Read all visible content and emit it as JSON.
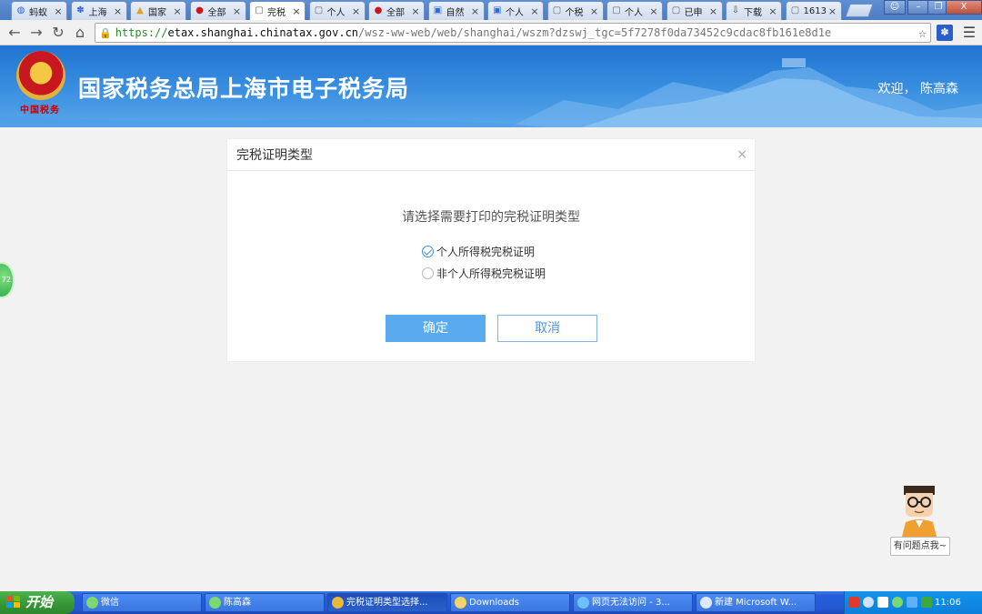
{
  "browser": {
    "tabs": [
      {
        "label": "蚂蚁",
        "icon": "globe-icon",
        "active": false
      },
      {
        "label": "上海",
        "icon": "paw-icon",
        "active": false
      },
      {
        "label": "国家",
        "icon": "bell-icon",
        "active": false
      },
      {
        "label": "全部",
        "icon": "emblem-icon",
        "active": false
      },
      {
        "label": "完税",
        "icon": "page-icon",
        "active": true
      },
      {
        "label": "个人",
        "icon": "page-icon",
        "active": false
      },
      {
        "label": "全部",
        "icon": "emblem-icon",
        "active": false
      },
      {
        "label": "自然",
        "icon": "tax-icon",
        "active": false
      },
      {
        "label": "个人",
        "icon": "tax-icon",
        "active": false
      },
      {
        "label": "个税",
        "icon": "page-icon",
        "active": false
      },
      {
        "label": "个人",
        "icon": "page-icon",
        "active": false
      },
      {
        "label": "已申",
        "icon": "page-icon",
        "active": false
      },
      {
        "label": "下载",
        "icon": "download-icon",
        "active": false
      },
      {
        "label": "1613",
        "icon": "page-icon",
        "active": false
      }
    ],
    "tab_close_glyph": "×",
    "url": {
      "scheme": "https://",
      "host": "etax.shanghai.chinatax.gov.cn",
      "path": "/wsz-ww-web/web/shanghai/wszm?dzswj_tgc=5f7278f0da73452c9cdac8fb161e8d1e"
    }
  },
  "site": {
    "title": "国家税务总局上海市电子税务局",
    "emblem_caption": "中国税务",
    "welcome": "欢迎，  陈高森"
  },
  "modal": {
    "title": "完税证明类型",
    "close_glyph": "×",
    "prompt": "请选择需要打印的完税证明类型",
    "options": [
      {
        "label": "个人所得税完税证明",
        "checked": true
      },
      {
        "label": "非个人所得税完税证明",
        "checked": false
      }
    ],
    "ok_label": "确定",
    "cancel_label": "取消"
  },
  "widgets": {
    "side_ball_text": "72",
    "helper_label": "有问题点我~"
  },
  "taskbar": {
    "start_label": "开始",
    "tasks": [
      {
        "label": "微信",
        "active": false
      },
      {
        "label": "陈高森",
        "active": false
      },
      {
        "label": "完税证明类型选择...",
        "active": true
      },
      {
        "label": "Downloads",
        "active": false
      },
      {
        "label": "网页无法访问 - 3...",
        "active": false
      },
      {
        "label": "新建 Microsoft W...",
        "active": false
      }
    ],
    "clock": "11:06"
  },
  "colors": {
    "accent": "#5aaaf0",
    "banner": "#2a7fd8",
    "taskbar": "#245edb",
    "start": "#379a37"
  }
}
